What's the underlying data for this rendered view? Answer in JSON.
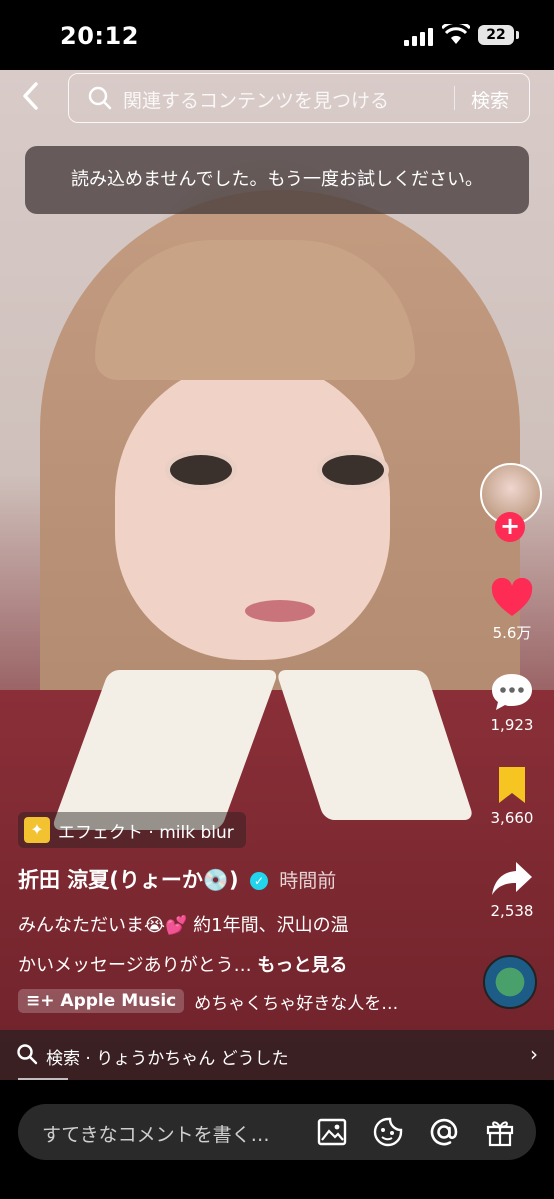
{
  "status": {
    "time": "20:12",
    "battery": "22"
  },
  "search": {
    "placeholder": "関連するコンテンツを見つける",
    "button": "検索"
  },
  "toast": "読み込めませんでした。もう一度お試しください。",
  "actions": {
    "likes": "5.6万",
    "comments": "1,923",
    "saves": "3,660",
    "shares": "2,538"
  },
  "video": {
    "effect_label": "エフェクト · milk blur",
    "author": "折田 涼夏(りょーか💿)",
    "time_ago": "時間前",
    "caption_line1": "みんなただいま😭💕 約1年間、沢山の温",
    "caption_line2": "かいメッセージありがとう…",
    "more": "もっと見る",
    "music_badge": "Apple Music",
    "music_text": "めちゃくちゃ好きな人を…"
  },
  "related_search": "検索 · りょうかちゃん どうした",
  "comment": {
    "placeholder": "すてきなコメントを書く…"
  },
  "colors": {
    "like": "#fe2c55",
    "save": "#f6c522",
    "verified": "#20d5ec"
  }
}
